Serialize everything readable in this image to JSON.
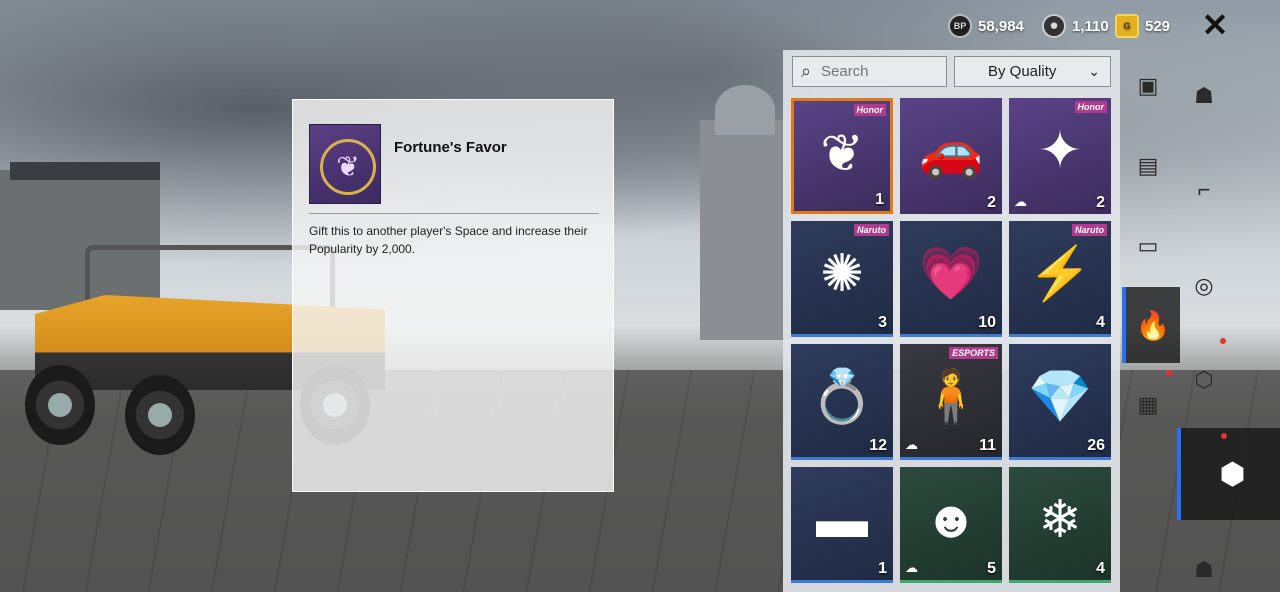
{
  "currency": {
    "bp": {
      "icon": "bp-coin-icon",
      "label": "BP",
      "value": "58,984"
    },
    "ag": {
      "icon": "ag-coin-icon",
      "value": "1,110"
    },
    "uc": {
      "icon": "uc-coin-icon",
      "label": "G",
      "value": "529"
    }
  },
  "close": {
    "icon": "close-icon",
    "glyph": "✕"
  },
  "item_detail": {
    "name": "Fortune's Favor",
    "description": "Gift this to another player's Space and increase their Popularity by 2,000."
  },
  "inventory": {
    "search_placeholder": "Search",
    "sort_label": "By Quality",
    "items": [
      {
        "name": "fortunes-favor-emblem",
        "glyph": "❦",
        "count": "1",
        "badge": "Honor",
        "quality": "purple",
        "selected": true,
        "cloud": false
      },
      {
        "name": "yellow-sports-car",
        "glyph": "🚗",
        "count": "2",
        "badge": "",
        "quality": "purple",
        "selected": false,
        "cloud": false
      },
      {
        "name": "dark-emblem",
        "glyph": "✦",
        "count": "2",
        "badge": "Honor",
        "quality": "purple",
        "selected": false,
        "cloud": true
      },
      {
        "name": "nine-tails-emblem",
        "glyph": "✺",
        "count": "3",
        "badge": "Naruto",
        "quality": "blue",
        "selected": false,
        "cloud": false
      },
      {
        "name": "finger-heart-gesture",
        "glyph": "💗",
        "count": "10",
        "badge": "",
        "quality": "blue",
        "selected": false,
        "cloud": false
      },
      {
        "name": "naruto-figure",
        "glyph": "⚡",
        "count": "4",
        "badge": "Naruto",
        "quality": "blue",
        "selected": false,
        "cloud": false
      },
      {
        "name": "emerald-ring",
        "glyph": "💍",
        "count": "12",
        "badge": "",
        "quality": "blue",
        "selected": false,
        "cloud": false
      },
      {
        "name": "esports-outfit",
        "glyph": "🧍",
        "count": "11",
        "badge": "ESPORTS",
        "quality": "dark",
        "selected": false,
        "cloud": true
      },
      {
        "name": "crystal-gold-bar",
        "glyph": "💎",
        "count": "26",
        "badge": "",
        "quality": "blue",
        "selected": false,
        "cloud": false
      },
      {
        "name": "gold-bar",
        "glyph": "▬",
        "count": "1",
        "badge": "",
        "quality": "blue",
        "selected": false,
        "cloud": false
      },
      {
        "name": "gas-mask-head",
        "glyph": "☻",
        "count": "5",
        "badge": "",
        "quality": "green",
        "selected": false,
        "cloud": true
      },
      {
        "name": "snow-globe-toy",
        "glyph": "❄",
        "count": "4",
        "badge": "",
        "quality": "green",
        "selected": false,
        "cloud": false
      }
    ]
  },
  "sidebar": {
    "icons": [
      "crate-icon",
      "character-icon",
      "ticket-icon",
      "gun-icon",
      "vehicle-icon",
      "steering-wheel-icon",
      "flame-icon",
      "box-icon",
      "chest-icon",
      "cube-icon",
      "soldier-icon"
    ]
  }
}
